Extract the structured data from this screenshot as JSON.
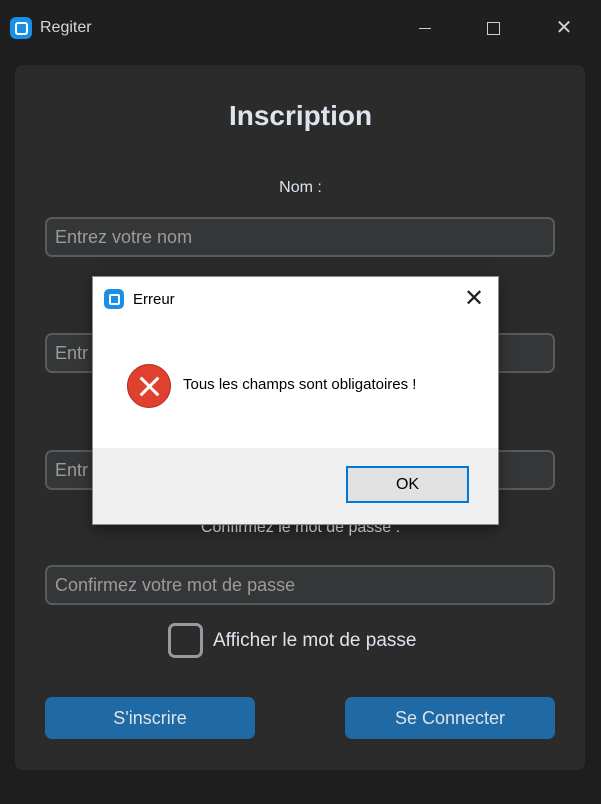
{
  "window": {
    "title": "Regiter"
  },
  "form": {
    "heading": "Inscription",
    "name_label": "Nom :",
    "name_placeholder": "Entrez votre nom",
    "email_placeholder_partial": "Entr",
    "password_placeholder_partial": "Entr",
    "confirm_label": "Confirmez le mot de passe :",
    "confirm_placeholder": "Confirmez votre mot de passe",
    "show_password_label": "Afficher le mot de passe",
    "register_button": "S'inscrire",
    "login_button": "Se Connecter"
  },
  "dialog": {
    "title": "Erreur",
    "message": "Tous les champs sont obligatoires !",
    "ok_button": "OK"
  },
  "colors": {
    "background": "#1e1e1e",
    "frame": "#2b2b2b",
    "accent": "#1f6aa5",
    "error": "#e0412f"
  }
}
